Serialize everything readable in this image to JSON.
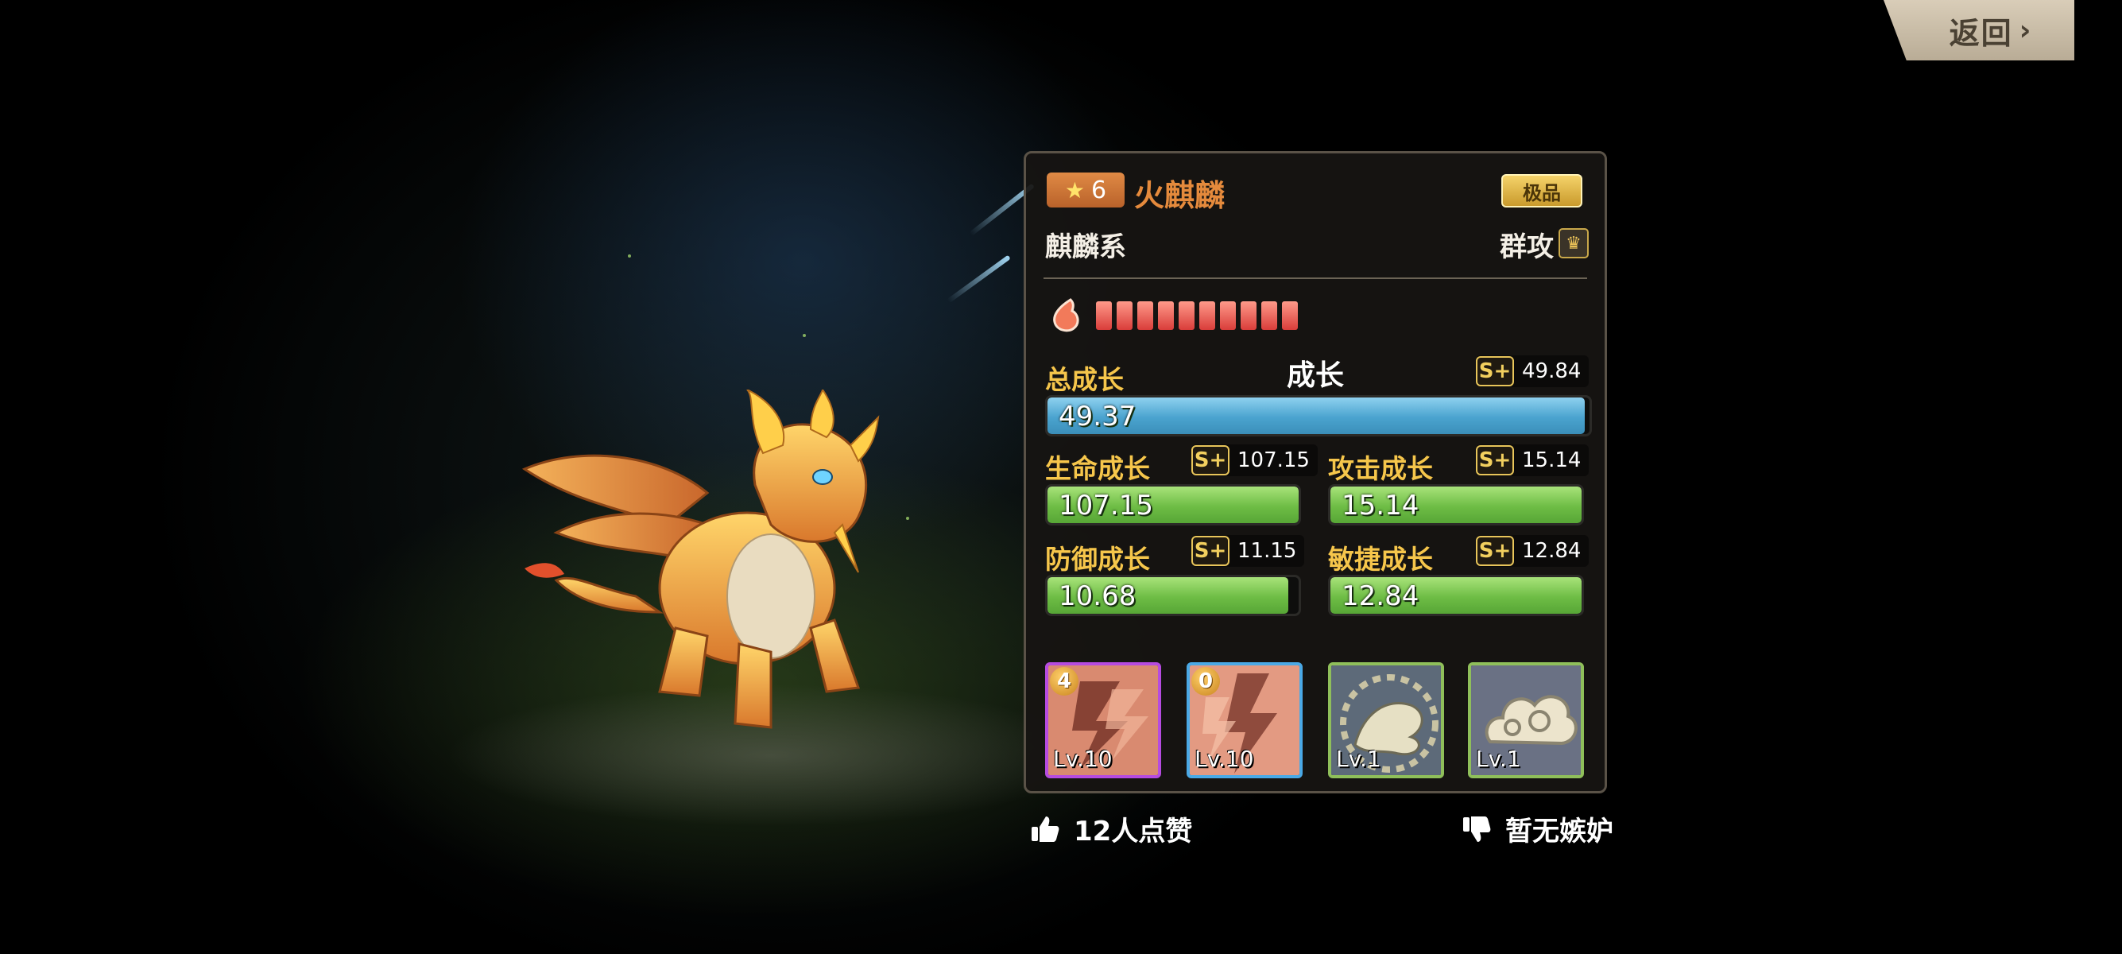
{
  "nav": {
    "back_label": "返回",
    "back_chevron": "›"
  },
  "pet": {
    "stars": "6",
    "star_icon": "star-icon",
    "name": "火麒麟",
    "rarity": "极品",
    "family": "麒麟系",
    "attack_type": "群攻",
    "attack_type_icon": "crown-emblem-icon",
    "element_icon": "fire-drop-icon",
    "pip_count": 10
  },
  "growth": {
    "title": "成长",
    "total": {
      "label": "总成长",
      "grade": "S+",
      "max": "49.84",
      "value": "49.37",
      "fill_ratio": 0.9906
    },
    "hp": {
      "label": "生命成长",
      "grade": "S+",
      "max": "107.15",
      "value": "107.15",
      "fill_ratio": 1.0
    },
    "atk": {
      "label": "攻击成长",
      "grade": "S+",
      "max": "15.14",
      "value": "15.14",
      "fill_ratio": 1.0
    },
    "def": {
      "label": "防御成长",
      "grade": "S+",
      "max": "11.15",
      "value": "10.68",
      "fill_ratio": 0.9578
    },
    "agi": {
      "label": "敏捷成长",
      "grade": "S+",
      "max": "12.84",
      "value": "12.84",
      "fill_ratio": 1.0
    }
  },
  "skills": [
    {
      "badge": "4",
      "level": "Lv.10",
      "frame": "#b64be0",
      "icon": "lightning-skill-icon"
    },
    {
      "badge": "0",
      "level": "Lv.10",
      "frame": "#4aa9e6",
      "icon": "lightning-skill-icon"
    },
    {
      "badge": "",
      "level": "Lv.1",
      "frame": "#8fbf5a",
      "icon": "dragon-skill-icon"
    },
    {
      "badge": "",
      "level": "Lv.1",
      "frame": "#8fbf5a",
      "icon": "cloud-skill-icon"
    }
  ],
  "footer": {
    "likes": "12人点赞",
    "envy": "暂无嫉妒"
  }
}
